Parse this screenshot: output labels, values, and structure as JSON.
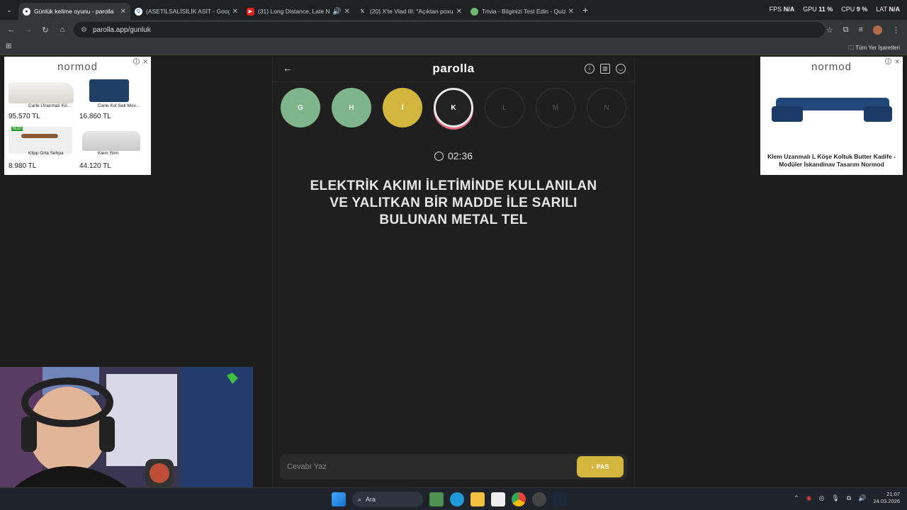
{
  "browser": {
    "tabs": [
      {
        "title": "Günlük kelime oyunu - parolla",
        "active": true
      },
      {
        "title": "(ASETİLSALİSİLİK ASİT - Google",
        "active": false
      },
      {
        "title": "(31) Long Distance, Late Ni",
        "active": false
      },
      {
        "title": "(20) X'te Vlad III: \"Açıktan poxu",
        "active": false
      },
      {
        "title": "Trivia - Bilginizi Test Edin - Quiz",
        "active": false
      }
    ],
    "url": "parolla.app/gunluk",
    "bookmarks_all": "Tüm Yer İşaretleri",
    "stats": {
      "fps_label": "FPS",
      "fps": "N/A",
      "gpu_label": "GPU",
      "gpu": "11 %",
      "cpu_label": "CPU",
      "cpu": "9 %",
      "lat_label": "LAT",
      "lat": "N/A"
    }
  },
  "ads": {
    "left": {
      "brand": "normod",
      "products": [
        {
          "name": "Carle Uzanmalı Kö...",
          "price": "95.570 TL"
        },
        {
          "name": "Carle Kol Seti Mov...",
          "price": "16.860 TL"
        },
        {
          "name": "Klipp Orta Sehpa",
          "price": "8.980 TL",
          "badge": "%10"
        },
        {
          "name": "Klem Slim",
          "price": "44.120 TL"
        }
      ]
    },
    "right": {
      "brand": "normod",
      "title": "Klem Uzanmalı L Köşe Koltuk Butter Kadife - Modüler İskandinav Tasarım Normod"
    }
  },
  "game": {
    "logo": "parolla",
    "letters": [
      {
        "letter": "G",
        "state": "done"
      },
      {
        "letter": "H",
        "state": "done"
      },
      {
        "letter": "İ",
        "state": "pass"
      },
      {
        "letter": "K",
        "state": "current"
      },
      {
        "letter": "L",
        "state": "todo"
      },
      {
        "letter": "M",
        "state": "todo"
      },
      {
        "letter": "N",
        "state": "todo"
      }
    ],
    "timer": "02:36",
    "question": "ELEKTRİK AKIMI İLETİMİNDE KULLANILAN VE YALITKAN BİR MADDE İLE SARILI BULUNAN METAL TEL",
    "answer_placeholder": "Cevabı Yaz",
    "pass_label": "PAS"
  },
  "taskbar": {
    "search": "Ara",
    "time": "21:07",
    "date": "24.03.2026"
  },
  "colors": {
    "done": "#7fb58a",
    "pass": "#d4b63e",
    "current_ring": "#e06a7a"
  }
}
